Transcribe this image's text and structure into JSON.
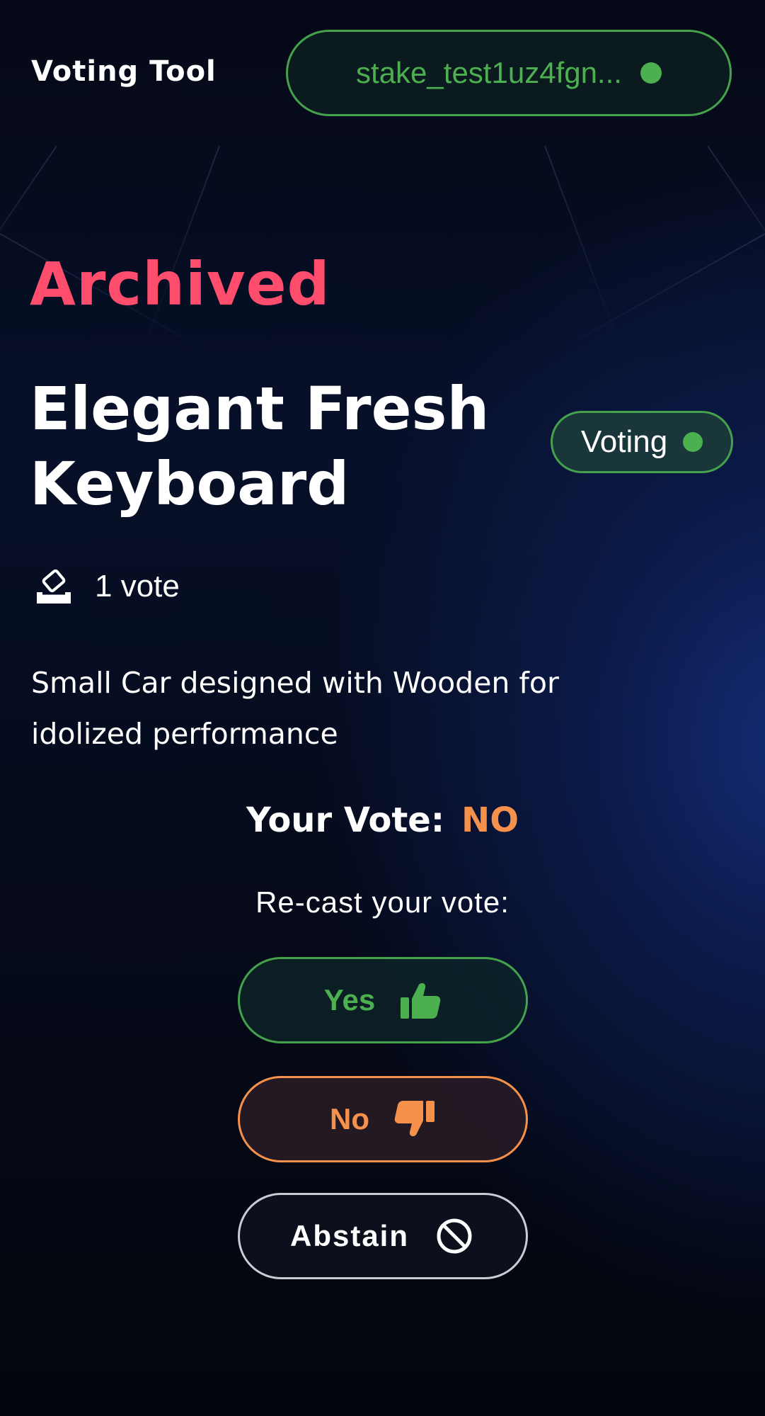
{
  "header": {
    "app_title": "Voting Tool",
    "wallet_address": "stake_test1uz4fgn...",
    "wallet_status_color": "#4caf50"
  },
  "proposal": {
    "status": "Archived",
    "title": "Elegant Fresh Keyboard",
    "phase_badge": "Voting",
    "vote_count": "1 vote",
    "description": "Small Car designed with Wooden for idolized performance"
  },
  "vote": {
    "your_vote_label": "Your Vote:",
    "your_vote_value": "NO",
    "recast_label": "Re-cast your vote:",
    "options": {
      "yes": "Yes",
      "no": "No",
      "abstain": "Abstain"
    }
  },
  "icons": {
    "votes": "ballot-box-icon",
    "yes": "thumbs-up-icon",
    "no": "thumbs-down-icon",
    "abstain": "ban-icon"
  },
  "colors": {
    "archived": "#ff4d6d",
    "success": "#4caf50",
    "no": "#f5914a",
    "background": "#050816"
  }
}
